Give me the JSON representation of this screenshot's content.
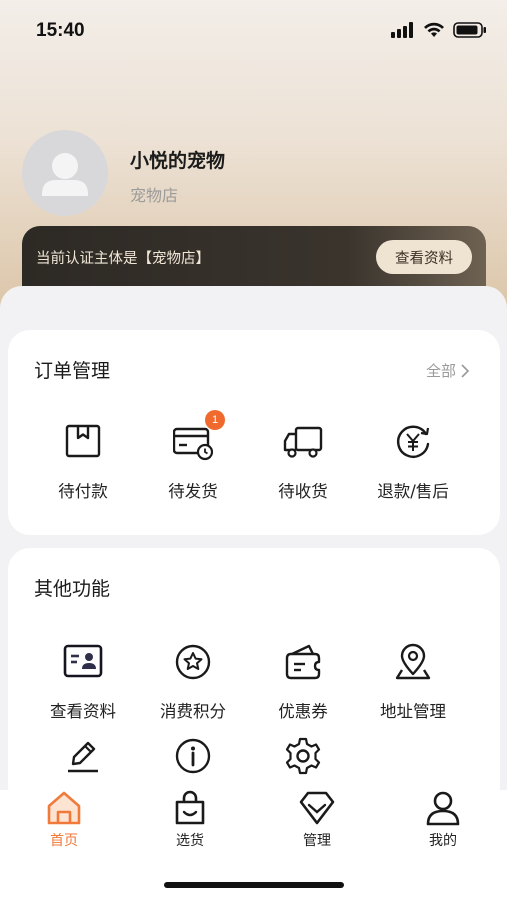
{
  "status_bar": {
    "time": "15:40"
  },
  "profile": {
    "name": "小悦的宠物",
    "subtitle": "宠物店"
  },
  "auth_bar": {
    "text": "当前认证主体是【宠物店】",
    "button_label": "查看资料"
  },
  "orders": {
    "title": "订单管理",
    "more_label": "全部",
    "items": [
      {
        "label": "待付款",
        "icon": "wallet-box-icon"
      },
      {
        "label": "待发货",
        "icon": "card-clock-icon",
        "badge": "1"
      },
      {
        "label": "待收货",
        "icon": "truck-icon"
      },
      {
        "label": "退款/售后",
        "icon": "refund-yen-icon"
      }
    ]
  },
  "other": {
    "title": "其他功能",
    "items": [
      {
        "label": "查看资料",
        "icon": "id-card-icon"
      },
      {
        "label": "消费积分",
        "icon": "star-circle-icon"
      },
      {
        "label": "优惠券",
        "icon": "coupon-wallet-icon"
      },
      {
        "label": "地址管理",
        "icon": "location-pin-icon"
      },
      {
        "label": "",
        "icon": "pen-edit-icon"
      },
      {
        "label": "",
        "icon": "info-circle-icon"
      },
      {
        "label": "",
        "icon": "gear-icon"
      }
    ]
  },
  "tabbar": {
    "items": [
      {
        "label": "首页",
        "icon": "home-icon",
        "active": true
      },
      {
        "label": "选货",
        "icon": "shopping-bag-icon"
      },
      {
        "label": "管理",
        "icon": "manage-diamond-icon"
      },
      {
        "label": "我的",
        "icon": "user-icon"
      }
    ]
  },
  "colors": {
    "accent": "#f07a3a",
    "badge": "#f06a2e",
    "auth_bar": "#2d2924"
  }
}
